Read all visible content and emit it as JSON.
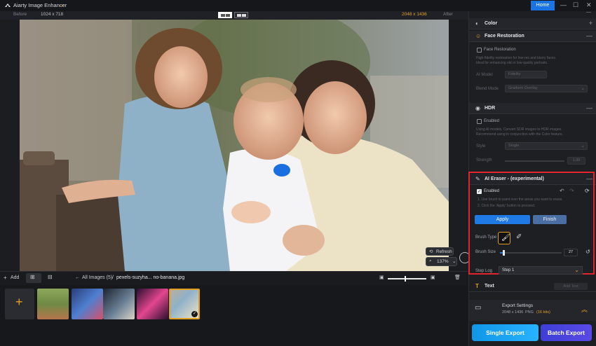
{
  "app": {
    "title": "Aiarty Image Enhancer",
    "home_label": "Home",
    "minimize_icon": "minimize-icon",
    "maximize_icon": "maximize-icon",
    "close_icon": "close-icon"
  },
  "compare": {
    "before_label": "Before",
    "before_size": "1024 x 718",
    "after_size": "2048 x 1436",
    "after_label": "After"
  },
  "view": {
    "refresh_label": "Refresh",
    "zoom_value": "137%"
  },
  "bottom": {
    "add_label": "Add",
    "all_images_label": "All Images (5)",
    "path_separator": "/",
    "current_file": "pexels-suzyha... no-banana.jpg"
  },
  "thumbnails": [
    {
      "name": "thumb-1"
    },
    {
      "name": "thumb-2"
    },
    {
      "name": "thumb-3"
    },
    {
      "name": "thumb-4"
    },
    {
      "name": "thumb-5-selected"
    }
  ],
  "panel": {
    "color": {
      "title": "Color"
    },
    "face": {
      "title": "Face Restoration",
      "checkbox_label": "Face Restoration",
      "desc_line1": "High-fidelity restoration for low-res and blurry faces.",
      "desc_line2": "Ideal for enhancing old or low-quality portraits.",
      "ai_model_label": "AI Model",
      "ai_model_value": "Fidelity",
      "blend_label": "Blend Mode",
      "blend_value": "Gradient Overlay"
    },
    "hdr": {
      "title": "HDR",
      "checkbox_label": "Enabled",
      "desc_line1": "Using AI models, Convert SDR images to HDR images.",
      "desc_line2": "Recommend using in conjunction with the Color feature.",
      "style_label": "Style",
      "style_value": "Single",
      "strength_label": "Strength",
      "strength_value": "1.00"
    },
    "eraser": {
      "title": "AI Eraser - (experimental)",
      "enabled_label": "Enabled",
      "step1": "1. Use brush to paint over the areas you want to erase.",
      "step2": "2. Click the 'Apply' button to proceed.",
      "apply_label": "Apply",
      "finish_label": "Finish",
      "brush_type_label": "Brush Type",
      "brush_size_label": "Brush Size",
      "brush_size_value": "27",
      "brush_size_fraction": 0.04,
      "step_log_label": "Step Log",
      "step_log_value": "Step 1"
    },
    "text": {
      "title": "Text",
      "add_button": "Add Text"
    },
    "export": {
      "title": "Export Settings",
      "info_size": "2048 x 1436",
      "info_format": "PNG",
      "info_bits": "(16 bits)"
    },
    "single_export": "Single Export",
    "batch_export": "Batch Export"
  },
  "colors": {
    "accent_blue": "#1b74e4",
    "highlight_red": "#e0262c",
    "orange": "#e2a021"
  }
}
